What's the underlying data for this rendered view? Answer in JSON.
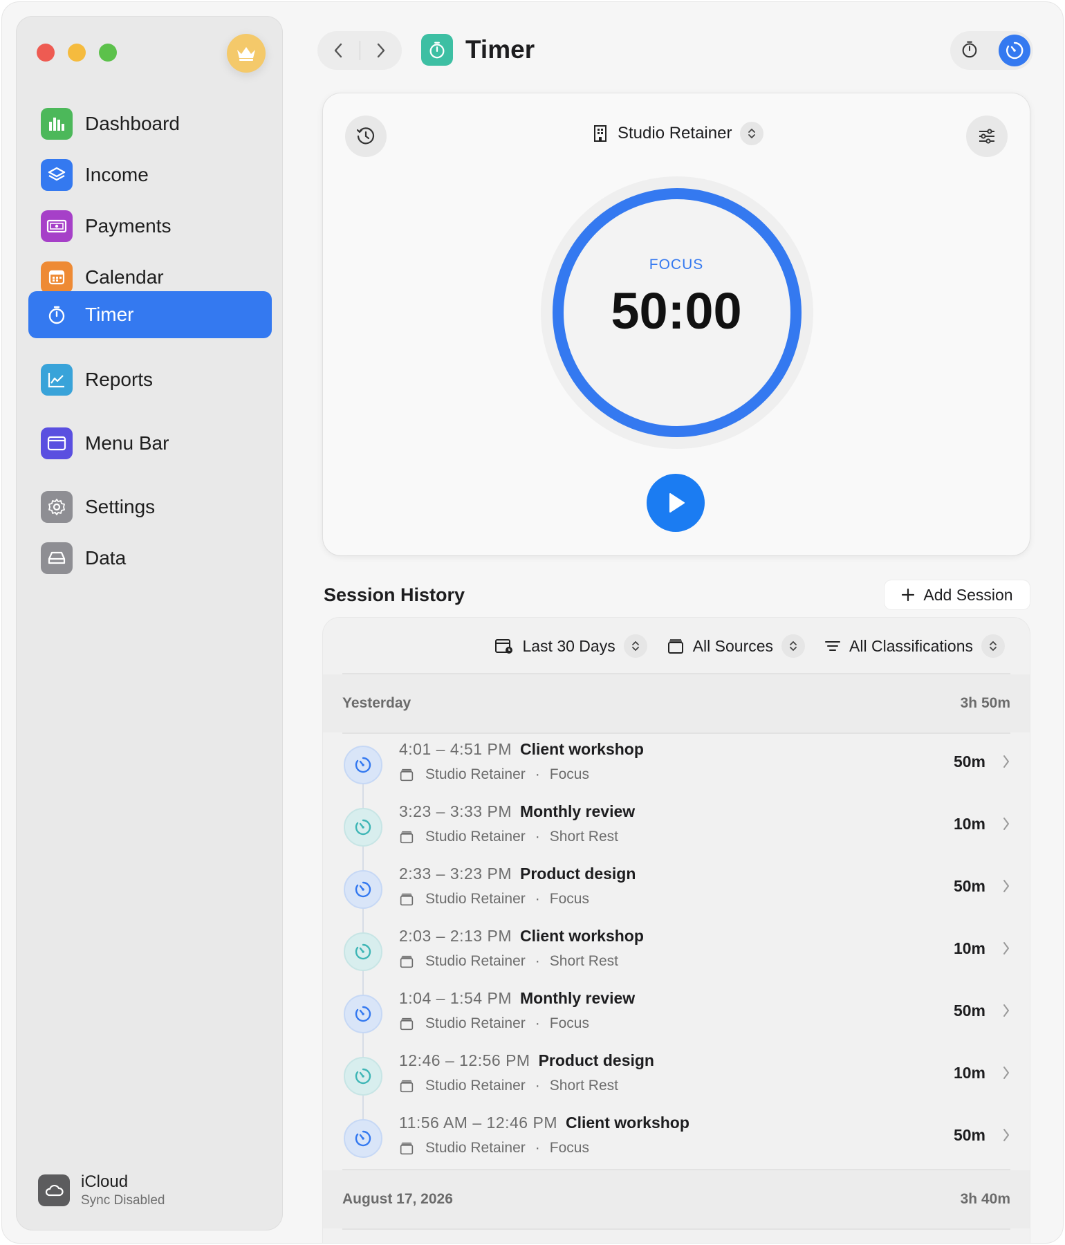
{
  "sidebar": {
    "items": [
      {
        "label": "Dashboard",
        "icon": "chart-bar-icon",
        "color": "#4cb85a"
      },
      {
        "label": "Income",
        "icon": "layers-icon",
        "color": "#3479f0"
      },
      {
        "label": "Payments",
        "icon": "banknote-icon",
        "color": "#a640c8"
      },
      {
        "label": "Calendar",
        "icon": "calendar-icon",
        "color": "#ee8a34"
      },
      {
        "label": "Timer",
        "icon": "stopwatch-icon",
        "color": "#3479f0",
        "active": true
      },
      {
        "label": "Reports",
        "icon": "line-chart-icon",
        "color": "#39a3d9"
      },
      {
        "label": "Menu Bar",
        "icon": "menubar-icon",
        "color": "#5a4fe0"
      },
      {
        "label": "Settings",
        "icon": "gear-icon",
        "color": "#8e8e93"
      },
      {
        "label": "Data",
        "icon": "drive-icon",
        "color": "#8e8e93"
      }
    ],
    "icloud": {
      "title": "iCloud",
      "subtitle": "Sync Disabled"
    }
  },
  "toolbar": {
    "title": "Timer"
  },
  "timer": {
    "source": "Studio Retainer",
    "mode": "FOCUS",
    "time": "50:00",
    "progress": 1.0
  },
  "history": {
    "title": "Session History",
    "add_label": "Add Session",
    "filters": {
      "range": "Last 30 Days",
      "sources": "All Sources",
      "classes": "All Classifications"
    },
    "groups": [
      {
        "label": "Yesterday",
        "total": "3h 50m"
      },
      {
        "label": "August 17, 2026",
        "total": "3h 40m"
      }
    ],
    "sessions": [
      {
        "time": "4:01 – 4:51 PM",
        "title": "Client workshop",
        "source": "Studio Retainer",
        "kind": "Focus",
        "duration": "50m"
      },
      {
        "time": "3:23 – 3:33 PM",
        "title": "Monthly review",
        "source": "Studio Retainer",
        "kind": "Short Rest",
        "duration": "10m"
      },
      {
        "time": "2:33 – 3:23 PM",
        "title": "Product design",
        "source": "Studio Retainer",
        "kind": "Focus",
        "duration": "50m"
      },
      {
        "time": "2:03 – 2:13 PM",
        "title": "Client workshop",
        "source": "Studio Retainer",
        "kind": "Short Rest",
        "duration": "10m"
      },
      {
        "time": "1:04 – 1:54 PM",
        "title": "Monthly review",
        "source": "Studio Retainer",
        "kind": "Focus",
        "duration": "50m"
      },
      {
        "time": "12:46 – 12:56 PM",
        "title": "Product design",
        "source": "Studio Retainer",
        "kind": "Short Rest",
        "duration": "10m"
      },
      {
        "time": "11:56 AM – 12:46 PM",
        "title": "Client workshop",
        "source": "Studio Retainer",
        "kind": "Focus",
        "duration": "50m"
      }
    ]
  },
  "colors": {
    "accent": "#3479f0",
    "play": "#1b7cf2",
    "timer_app": "#3dbfa3",
    "focus": "#3479f0",
    "rest": "#3fb6b6"
  }
}
